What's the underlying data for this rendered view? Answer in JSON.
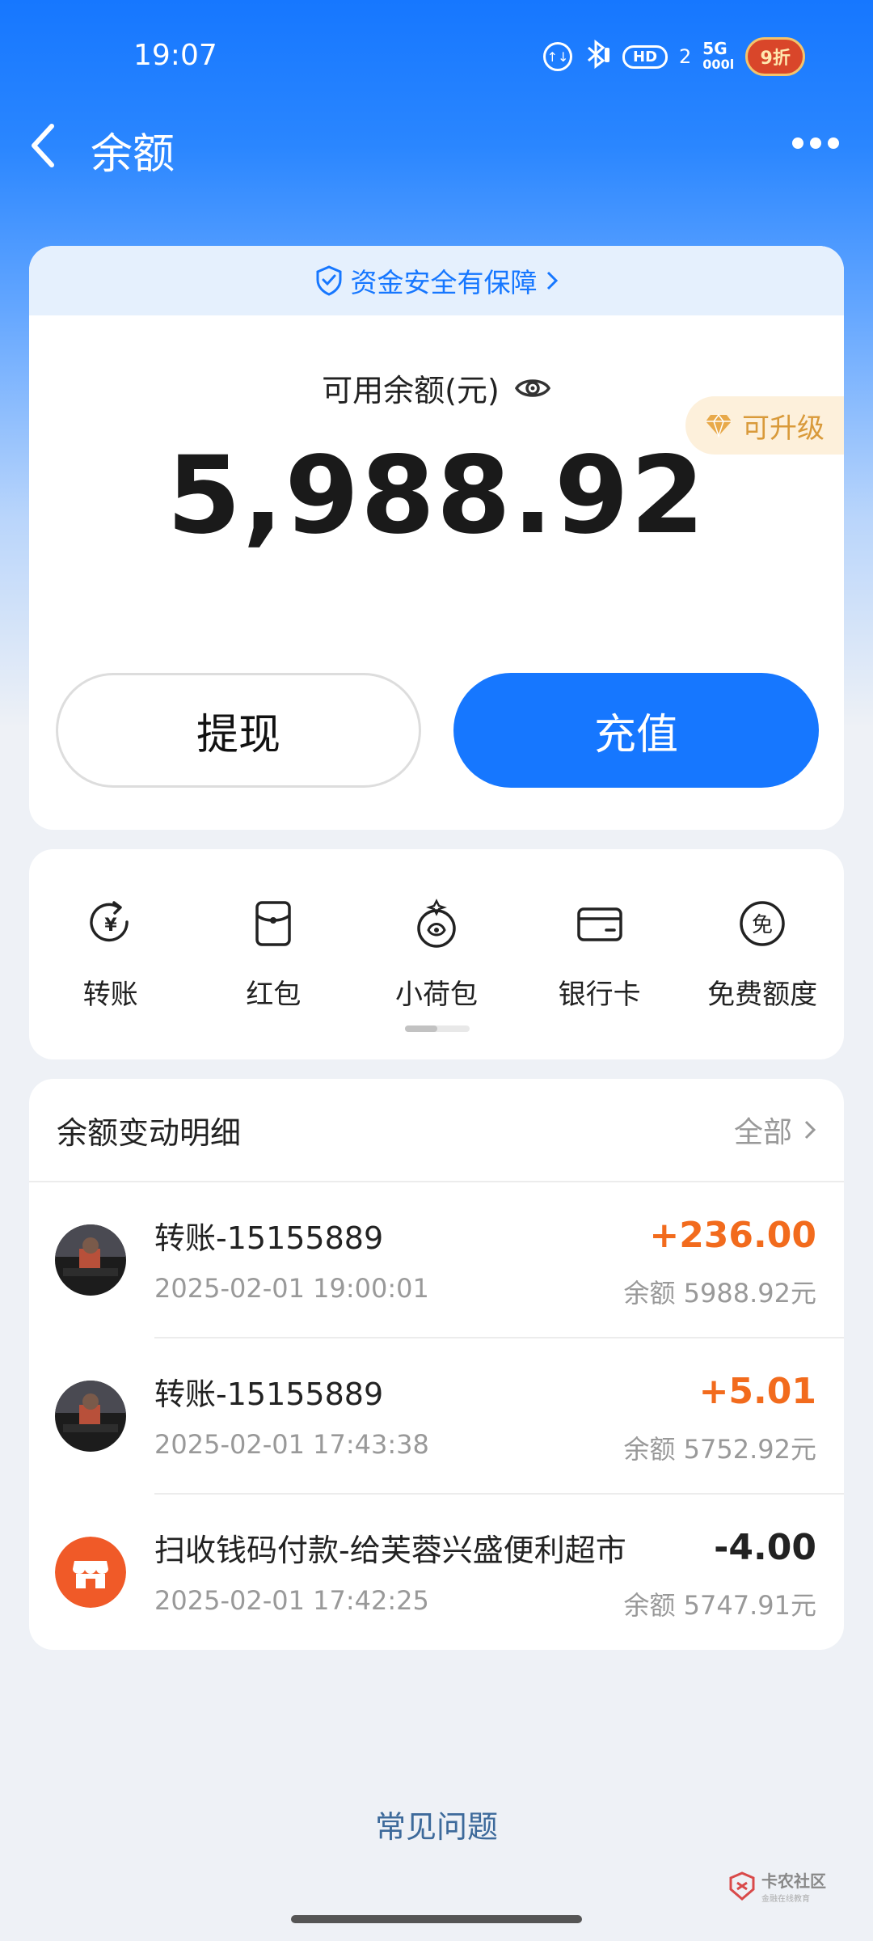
{
  "status_bar": {
    "time": "19:07",
    "icons": [
      "data-saver-icon",
      "bluetooth-icon",
      "hd-voice-icon",
      "5g-signal-icon",
      "promo-badge-icon"
    ],
    "hd_label": "HD",
    "sim_index": "2",
    "network_label": "5G",
    "badge_text": "9折"
  },
  "nav": {
    "title": "余额"
  },
  "balance_card": {
    "safety_banner": "资金安全有保障",
    "label": "可用余额(元)",
    "amount": "5,988.92",
    "upgrade_label": "可升级",
    "withdraw_label": "提现",
    "topup_label": "充值"
  },
  "quick_actions": [
    {
      "label": "转账",
      "icon": "transfer-icon"
    },
    {
      "label": "红包",
      "icon": "red-packet-icon"
    },
    {
      "label": "小荷包",
      "icon": "small-purse-icon"
    },
    {
      "label": "银行卡",
      "icon": "bank-card-icon"
    },
    {
      "label": "免费额度",
      "icon": "free-quota-icon"
    }
  ],
  "quick_actions_pager": {
    "page": 1,
    "pages": 2
  },
  "transactions": {
    "title": "余额变动明细",
    "all_label": "全部",
    "items": [
      {
        "name": "转账-15155889",
        "time": "2025-02-01 19:00:01",
        "amount": "+236.00",
        "balance": "余额 5988.92元",
        "type": "credit"
      },
      {
        "name": "转账-15155889",
        "time": "2025-02-01 17:43:38",
        "amount": "+5.01",
        "balance": "余额 5752.92元",
        "type": "credit"
      },
      {
        "name": "扫收钱码付款-给芙蓉兴盛便利超市",
        "time": "2025-02-01 17:42:25",
        "amount": "-4.00",
        "balance": "余额 5747.91元",
        "type": "debit"
      }
    ]
  },
  "faq_label": "常见问题",
  "watermark": {
    "line1": "卡农社区",
    "line2": "金融在线教育"
  },
  "colors": {
    "primary": "#1677ff",
    "credit": "#f26b1d",
    "upgrade": "#d99a3a",
    "store_icon": "#f05a28"
  }
}
